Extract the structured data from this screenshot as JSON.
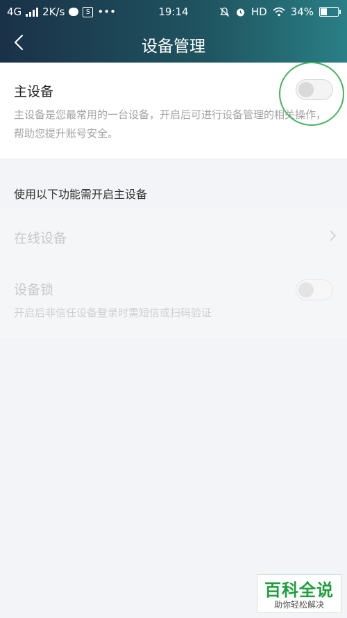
{
  "status_bar": {
    "network": "4G",
    "speed": "2K/s",
    "time": "19:14",
    "hd": "HD",
    "battery": "34%",
    "icons": [
      "signal-icon",
      "wechat-icon",
      "s-app-icon",
      "more-dots-icon",
      "mute-icon",
      "alarm-icon",
      "wifi-icon",
      "battery-icon"
    ],
    "battery_level": 0.34
  },
  "nav": {
    "title": "设备管理",
    "back_icon": "chevron-left-icon"
  },
  "main_device": {
    "title": "主设备",
    "description": "主设备是您最常用的一台设备，开启后可进行设备管理的相关操作，帮助您提升账号安全。",
    "toggle_on": false
  },
  "section": {
    "label": "使用以下功能需开启主设备"
  },
  "online_devices": {
    "label": "在线设备",
    "icon": "chevron-right-icon"
  },
  "device_lock": {
    "label": "设备锁",
    "description": "开启后非信任设备登录时需短信或扫码验证",
    "toggle_on": false
  },
  "watermark": {
    "title": "百科全说",
    "subtitle": "助你轻松解决"
  },
  "colors": {
    "header_start": "#1a3148",
    "header_end": "#2a7f86",
    "highlight": "#44b25c",
    "watermark_green": "#1e9e3c"
  }
}
